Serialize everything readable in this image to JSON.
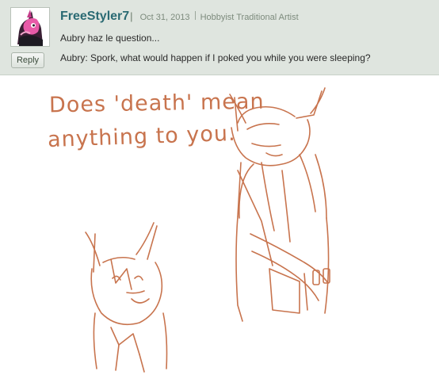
{
  "comment": {
    "author": "FreeStyler7",
    "author_symbol": "|",
    "date": "Oct 31, 2013",
    "user_title": "Hobbyist Traditional Artist",
    "lines": [
      "Aubry haz le question...",
      "Aubry: Spork, what would happen if I poked you while you were sleeping?"
    ],
    "reply_label": "Reply"
  },
  "drawing": {
    "caption_lines": [
      "Does 'death' mean",
      "anything to you."
    ]
  },
  "colors": {
    "comment_bg": "#dfe5df",
    "username": "#2a6a73",
    "sketch": "#c8744e"
  }
}
